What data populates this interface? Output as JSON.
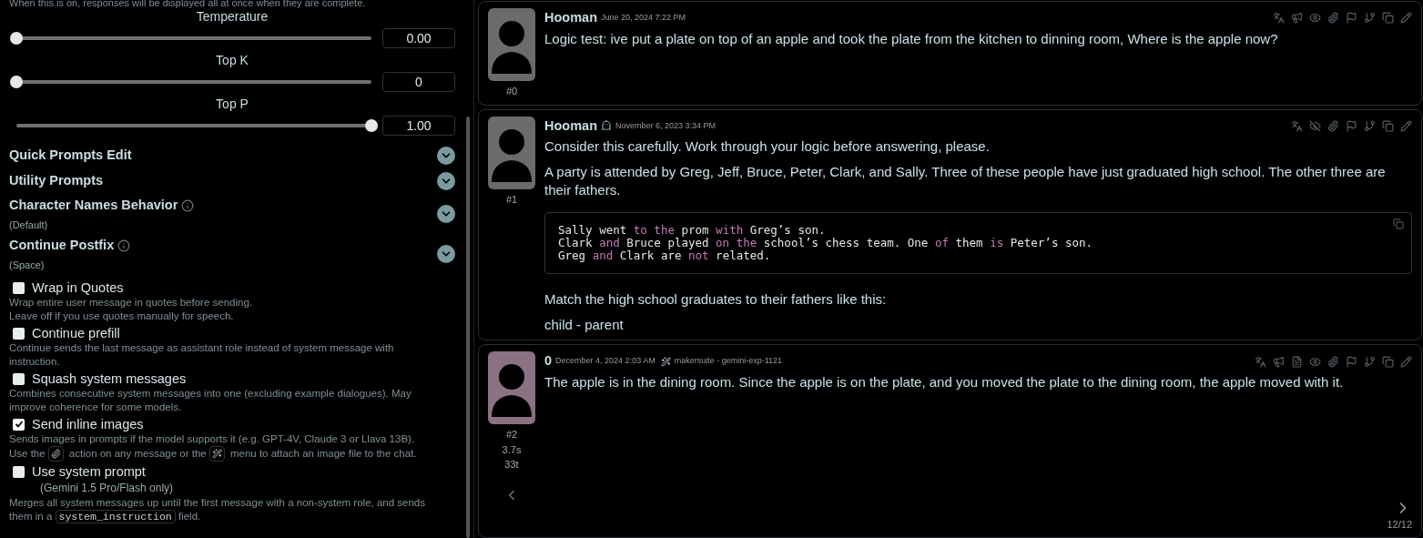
{
  "settings": {
    "intro_note": "When this is on, responses will be displayed all at once when they are complete.",
    "sliders": [
      {
        "label": "Temperature",
        "level": 0,
        "value": "0.00"
      },
      {
        "label": "Top K",
        "level": 0,
        "value": "0"
      },
      {
        "label": "Top P",
        "level": 1,
        "value": "1.00"
      }
    ],
    "sections": [
      {
        "title": "Quick Prompts Edit",
        "info": false
      },
      {
        "title": "Utility Prompts",
        "info": false
      },
      {
        "title": "Character Names Behavior",
        "info": true,
        "subtitle": "(Default)"
      },
      {
        "title": "Continue Postfix",
        "info": true,
        "subtitle": "(Space)"
      }
    ],
    "options": [
      {
        "label": "Wrap in Quotes",
        "checked": false,
        "description": [
          [
            {
              "kind": "text",
              "text": "Wrap entire user message in quotes before sending."
            }
          ],
          [
            {
              "kind": "text",
              "text": "Leave off if you use quotes manually for speech."
            }
          ]
        ]
      },
      {
        "label": "Continue prefill",
        "checked": false,
        "description": [
          [
            {
              "kind": "text",
              "text": "Continue sends the last message as assistant role instead of system message with instruction."
            }
          ]
        ]
      },
      {
        "label": "Squash system messages",
        "checked": false,
        "description": [
          [
            {
              "kind": "text",
              "text": "Combines consecutive system messages into one (excluding example dialogues). May improve coherence for some models."
            }
          ]
        ]
      },
      {
        "label": "Send inline images",
        "checked": true,
        "description": [
          [
            {
              "kind": "text",
              "text": "Sends images in prompts if the model supports it (e.g. GPT-4V, Claude 3 or Llava 13B)."
            }
          ],
          [
            {
              "kind": "text",
              "text": "Use the"
            },
            {
              "kind": "paperclip"
            },
            {
              "kind": "text",
              "text": "action on any message or the"
            },
            {
              "kind": "wand"
            },
            {
              "kind": "text",
              "text": "menu to attach an image file to the chat."
            }
          ]
        ]
      },
      {
        "label": "Use system prompt",
        "checked": false,
        "note": "(Gemini 1.5 Pro/Flash only)",
        "description": [
          [
            {
              "kind": "text",
              "text": "Merges all system messages up until the first message with a non-system role, and sends them in a"
            },
            {
              "kind": "code",
              "text": "system_instruction"
            },
            {
              "kind": "text",
              "text": "field."
            }
          ]
        ]
      }
    ]
  },
  "messages": [
    {
      "kind": "user",
      "name": "Hooman",
      "ghost": false,
      "date": "June 20, 2024 7:22 PM",
      "index": "#0",
      "actions": [
        {
          "kind": "translate"
        },
        {
          "kind": "narrate"
        },
        {
          "kind": "visible"
        },
        {
          "kind": "attach"
        },
        {
          "kind": "checkpoint"
        },
        {
          "kind": "branch"
        },
        {
          "kind": "copy"
        },
        {
          "kind": "edit"
        }
      ],
      "body": [
        {
          "kind": "text",
          "text": "Logic test: ive put a plate on top of an apple and took the plate from the kitchen to dinning room, Where is the apple now?"
        }
      ]
    },
    {
      "kind": "user",
      "name": "Hooman",
      "ghost": true,
      "date": "November 6, 2023 3:34 PM",
      "index": "#1",
      "actions": [
        {
          "kind": "translate"
        },
        {
          "kind": "hidden"
        },
        {
          "kind": "attach"
        },
        {
          "kind": "checkpoint"
        },
        {
          "kind": "branch"
        },
        {
          "kind": "copy"
        },
        {
          "kind": "edit"
        }
      ],
      "body": [
        {
          "kind": "text",
          "text": "Consider this carefully. Work through your logic before answering, please."
        },
        {
          "kind": "text",
          "text": "A party is attended by Greg, Jeff, Bruce, Peter, Clark, and Sally. Three of these people have just graduated high school. The other three are their fathers."
        },
        {
          "kind": "code",
          "lines": [
            [
              {
                "t": "Sally went ",
                "k": false
              },
              {
                "t": "to the",
                "k": true
              },
              {
                "t": " prom ",
                "k": false
              },
              {
                "t": "with",
                "k": true
              },
              {
                "t": " Greg’s son.",
                "k": false
              }
            ],
            [
              {
                "t": "Clark ",
                "k": false
              },
              {
                "t": "and",
                "k": true
              },
              {
                "t": " Bruce played ",
                "k": false
              },
              {
                "t": "on the",
                "k": true
              },
              {
                "t": " school’s chess team. One ",
                "k": false
              },
              {
                "t": "of",
                "k": true
              },
              {
                "t": " them ",
                "k": false
              },
              {
                "t": "is",
                "k": true
              },
              {
                "t": " Peter’s son.",
                "k": false
              }
            ],
            [
              {
                "t": "Greg ",
                "k": false
              },
              {
                "t": "and",
                "k": true
              },
              {
                "t": " Clark are ",
                "k": false
              },
              {
                "t": "not",
                "k": true
              },
              {
                "t": " related.",
                "k": false
              }
            ]
          ]
        },
        {
          "kind": "text",
          "text": "Match the high school graduates to their fathers like this:"
        },
        {
          "kind": "text",
          "text": "child - parent"
        }
      ]
    },
    {
      "kind": "character",
      "name": "0",
      "ghost": false,
      "date": "December 4, 2024 2:03 AM",
      "model": "makersuite - gemini-exp-1121",
      "index": "#2",
      "timer": "3.7s",
      "tokens": "33t",
      "swipes": "12/12",
      "actions": [
        {
          "kind": "translate"
        },
        {
          "kind": "narrate"
        },
        {
          "kind": "prompt"
        },
        {
          "kind": "visible"
        },
        {
          "kind": "attach"
        },
        {
          "kind": "checkpoint"
        },
        {
          "kind": "branch"
        },
        {
          "kind": "copy"
        },
        {
          "kind": "edit"
        }
      ],
      "body": [
        {
          "kind": "text",
          "text": "The apple is in the dining room. Since the apple is on the plate, and you moved the plate to the dining room, the apple moved with it."
        }
      ]
    }
  ]
}
